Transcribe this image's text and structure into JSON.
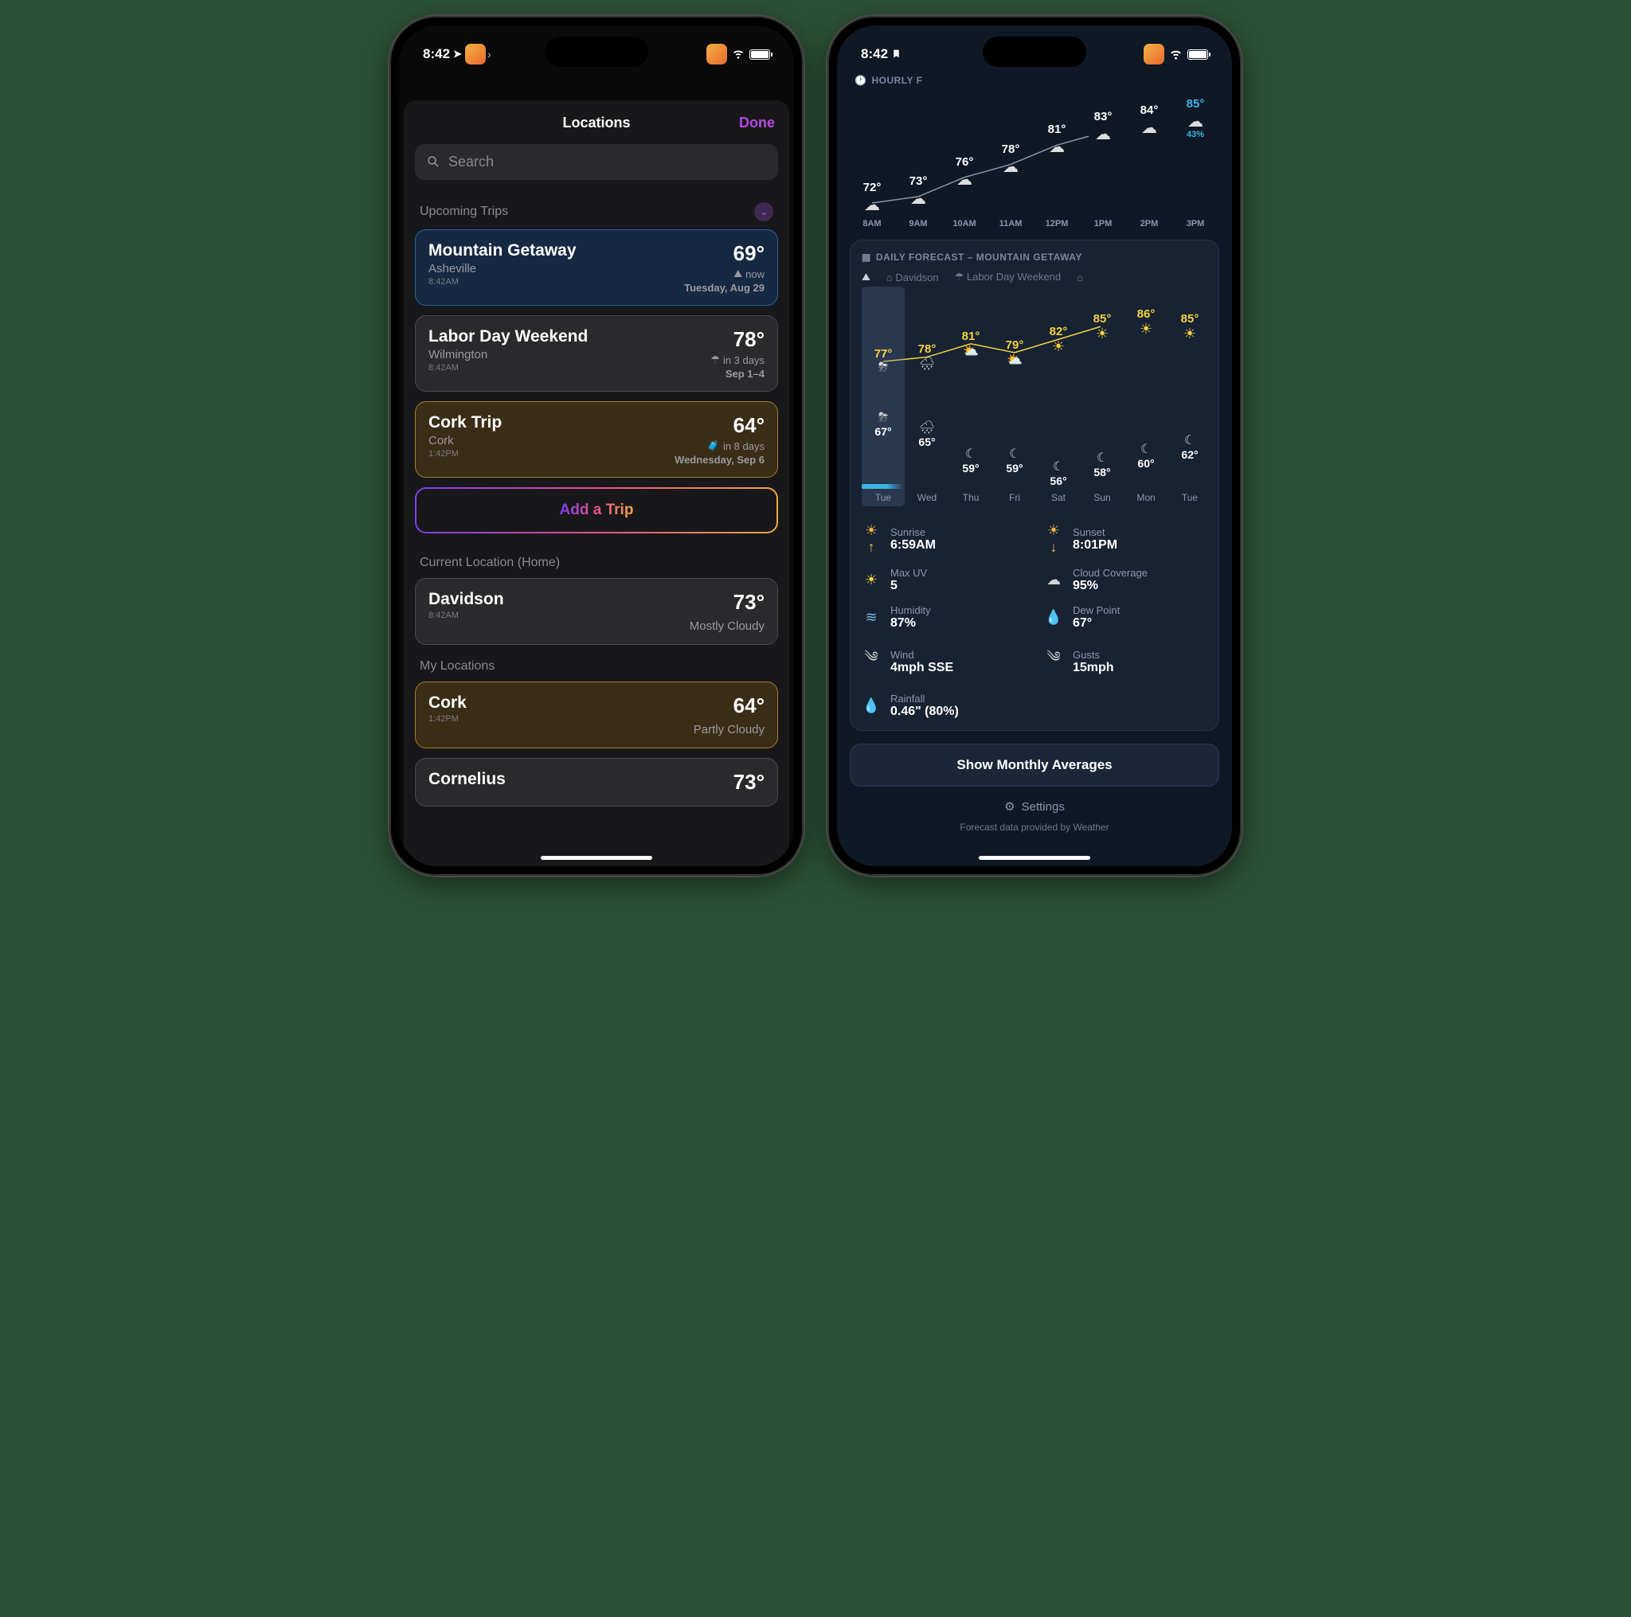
{
  "status": {
    "time": "8:42",
    "bookmark": true
  },
  "screen1": {
    "title": "Locations",
    "done": "Done",
    "search_placeholder": "Search",
    "sections": {
      "upcoming": "Upcoming Trips",
      "current": "Current Location (Home)",
      "my": "My Locations"
    },
    "trips": [
      {
        "name": "Mountain Getaway",
        "city": "Asheville",
        "time": "8:42AM",
        "temp": "69°",
        "status_icon": "mountain",
        "status": "now",
        "date": "Tuesday, Aug 29",
        "style": "blue"
      },
      {
        "name": "Labor Day Weekend",
        "city": "Wilmington",
        "time": "8:42AM",
        "temp": "78°",
        "status_icon": "umbrella",
        "status": "in 3 days",
        "date": "Sep 1–4",
        "style": "gray"
      },
      {
        "name": "Cork Trip",
        "city": "Cork",
        "time": "1:42PM",
        "temp": "64°",
        "status_icon": "suitcase",
        "status": "in 8 days",
        "date": "Wednesday, Sep 6",
        "style": "brown"
      }
    ],
    "add_trip": "Add a Trip",
    "current_location": {
      "name": "Davidson",
      "time": "8:42AM",
      "temp": "73°",
      "cond": "Mostly Cloudy"
    },
    "my_locations": [
      {
        "name": "Cork",
        "time": "1:42PM",
        "temp": "64°",
        "cond": "Partly Cloudy",
        "style": "brown"
      },
      {
        "name": "Cornelius",
        "temp": "73°",
        "style": "gray"
      }
    ]
  },
  "screen2": {
    "hourly_title": "HOURLY F",
    "panel_title": "DAILY FORECAST – MOUNTAIN GETAWAY",
    "tabs": [
      {
        "icon": "mountain",
        "label": "",
        "active": true
      },
      {
        "icon": "home",
        "label": "Davidson"
      },
      {
        "icon": "umbrella",
        "label": "Labor Day Weekend"
      },
      {
        "icon": "home",
        "label": ""
      }
    ],
    "chart_data": {
      "hourly": {
        "type": "line",
        "x": [
          "8AM",
          "9AM",
          "10AM",
          "11AM",
          "12PM",
          "1PM",
          "2PM",
          "3PM"
        ],
        "temps": [
          72,
          73,
          76,
          78,
          81,
          83,
          84,
          85
        ],
        "icons": [
          "cloud",
          "cloud",
          "cloud",
          "cloud",
          "cloud",
          "cloud",
          "cloud",
          "cloud"
        ],
        "precip_pct": [
          null,
          null,
          null,
          null,
          null,
          null,
          null,
          43
        ],
        "highlight_last": true
      },
      "daily": {
        "type": "range",
        "days": [
          "Tue",
          "Wed",
          "Thu",
          "Fri",
          "Sat",
          "Sun",
          "Mon",
          "Tue"
        ],
        "hi": [
          77,
          78,
          81,
          79,
          82,
          85,
          86,
          85
        ],
        "lo": [
          67,
          65,
          59,
          59,
          56,
          58,
          60,
          62
        ],
        "hi_icons": [
          "storm",
          "rain",
          "partly",
          "partly",
          "sun",
          "sun",
          "sun",
          "sun"
        ],
        "lo_icons": [
          "storm",
          "rain",
          "night",
          "night",
          "night",
          "night",
          "night",
          "night"
        ],
        "selected_index": 0,
        "selected_precip": true
      }
    },
    "details": [
      {
        "icon": "sunrise",
        "label": "Sunrise",
        "value": "6:59AM"
      },
      {
        "icon": "sunset",
        "label": "Sunset",
        "value": "8:01PM"
      },
      {
        "icon": "sun",
        "label": "Max UV",
        "value": "5"
      },
      {
        "icon": "cloud",
        "label": "Cloud Coverage",
        "value": "95%"
      },
      {
        "icon": "humidity",
        "label": "Humidity",
        "value": "87%"
      },
      {
        "icon": "dew",
        "label": "Dew Point",
        "value": "67°"
      },
      {
        "icon": "wind",
        "label": "Wind",
        "value": "4mph SSE"
      },
      {
        "icon": "gust",
        "label": "Gusts",
        "value": "15mph"
      },
      {
        "icon": "rain",
        "label": "Rainfall",
        "value": "0.46\" (80%)"
      }
    ],
    "monthly_btn": "Show Monthly Averages",
    "settings": "Settings",
    "credit": "Forecast data provided by Weather"
  }
}
